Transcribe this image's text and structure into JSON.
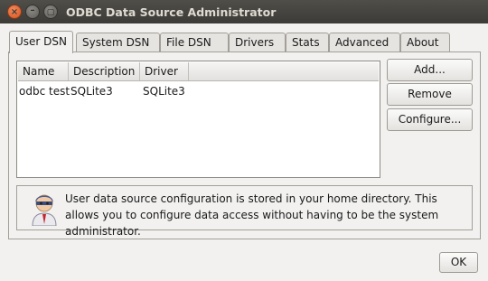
{
  "window": {
    "title": "ODBC Data Source Administrator",
    "close_glyph": "×",
    "minimize_glyph": "–",
    "maximize_glyph": "▢"
  },
  "tabs": [
    {
      "label": "User DSN",
      "active": true
    },
    {
      "label": "System DSN",
      "active": false
    },
    {
      "label": "File DSN",
      "active": false
    },
    {
      "label": "Drivers",
      "active": false
    },
    {
      "label": "Stats",
      "active": false
    },
    {
      "label": "Advanced",
      "active": false
    },
    {
      "label": "About",
      "active": false
    }
  ],
  "list": {
    "columns": [
      "Name",
      "Description",
      "Driver"
    ],
    "rows": [
      {
        "name": "odbc test",
        "description": "SQLite3",
        "driver": "SQLite3"
      }
    ]
  },
  "buttons": {
    "add": "Add...",
    "remove": "Remove",
    "configure": "Configure...",
    "ok": "OK"
  },
  "info": {
    "text": "User data source configuration is stored in your home directory. This allows you to configure data access without having to be the system administrator.",
    "icon": "user-icon"
  },
  "colors": {
    "titlebar": "#3c3b37",
    "close_button": "#d9531e",
    "window_bg": "#f2f1f0"
  }
}
